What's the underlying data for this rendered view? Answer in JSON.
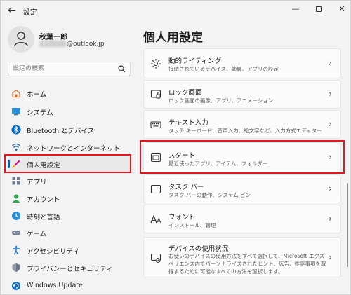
{
  "window": {
    "back_glyph": "←",
    "title": "設定",
    "minimize_glyph": "—",
    "close_glyph": "✕"
  },
  "user": {
    "name": "秋葉一郎",
    "email_suffix": "@outlook.jp"
  },
  "search": {
    "placeholder": "設定の検索"
  },
  "nav": {
    "items": [
      {
        "label": "ホーム",
        "icon": "home-icon"
      },
      {
        "label": "システム",
        "icon": "system-monitor-icon"
      },
      {
        "label": "Bluetooth とデバイス",
        "icon": "bluetooth-icon"
      },
      {
        "label": "ネットワークとインターネット",
        "icon": "network-icon"
      },
      {
        "label": "個人用設定",
        "icon": "brush-icon",
        "active": true
      },
      {
        "label": "アプリ",
        "icon": "apps-icon"
      },
      {
        "label": "アカウント",
        "icon": "account-icon"
      },
      {
        "label": "時刻と言語",
        "icon": "time-language-icon"
      },
      {
        "label": "ゲーム",
        "icon": "gamepad-icon"
      },
      {
        "label": "アクセシビリティ",
        "icon": "accessibility-icon"
      },
      {
        "label": "プライバシーとセキュリティ",
        "icon": "shield-icon"
      },
      {
        "label": "Windows Update",
        "icon": "windows-update-icon"
      }
    ]
  },
  "main": {
    "title": "個人用設定",
    "cards": [
      {
        "title": "動的ライティング",
        "desc": "接続されているデバイス、効果、アプリの設定",
        "icon": "dynamic-lighting-icon"
      },
      {
        "title": "ロック画面",
        "desc": "ロック画面の画像、アプリ、アニメーション",
        "icon": "lock-screen-icon"
      },
      {
        "title": "テキスト入力",
        "desc": "タッチ キーボード、音声入力、絵文字など、入力方式エディター",
        "icon": "keyboard-icon"
      },
      {
        "title": "スタート",
        "desc": "最近使ったアプリ、アイテム、フォルダー",
        "icon": "start-icon"
      },
      {
        "title": "タスク バー",
        "desc": "タスク バーの動作、システム ピン",
        "icon": "taskbar-icon"
      },
      {
        "title": "フォント",
        "desc": "インストール、管理",
        "icon": "font-icon"
      },
      {
        "title": "デバイスの使用状況",
        "desc": "お使いのデバイスの使用方法をすべて選択して、Microsoft エクスペリエンス内でパーソナライズされたヒント、広告、推奨事項を取得するために可能なすべての方法を選択します。",
        "icon": "device-usage-icon"
      }
    ],
    "chevron": "›"
  },
  "colors": {
    "accent": "#005fb8",
    "highlight_box": "#e8151f",
    "background": "#f3f3f3",
    "card": "#fbfbfb"
  }
}
